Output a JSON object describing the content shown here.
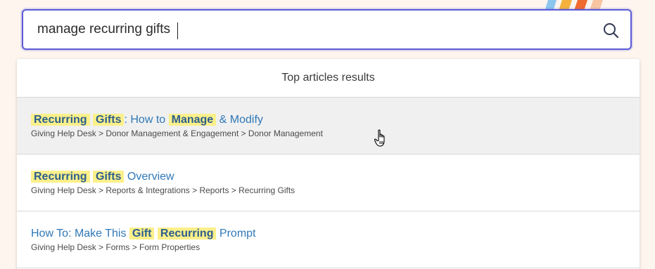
{
  "search": {
    "value": "manage recurring gifts",
    "icon": "search-icon"
  },
  "results": {
    "header": "Top articles results",
    "items": [
      {
        "title_parts": [
          {
            "text": "Recurring",
            "hl": true
          },
          {
            "text": " ",
            "hl": false
          },
          {
            "text": "Gifts",
            "hl": true
          },
          {
            "text": ": How to ",
            "hl": false
          },
          {
            "text": "Manage",
            "hl": true
          },
          {
            "text": " & Modify",
            "hl": false
          }
        ],
        "path": "Giving Help Desk > Donor Management & Engagement > Donor Management",
        "hovered": true
      },
      {
        "title_parts": [
          {
            "text": "Recurring",
            "hl": true
          },
          {
            "text": " ",
            "hl": false
          },
          {
            "text": "Gifts",
            "hl": true
          },
          {
            "text": " Overview",
            "hl": false
          }
        ],
        "path": "Giving Help Desk > Reports & Integrations > Reports > Recurring Gifts",
        "hovered": false
      },
      {
        "title_parts": [
          {
            "text": "How To: Make This ",
            "hl": false
          },
          {
            "text": "Gift",
            "hl": true
          },
          {
            "text": " ",
            "hl": false
          },
          {
            "text": "Recurring",
            "hl": true
          },
          {
            "text": " Prompt",
            "hl": false
          }
        ],
        "path": "Giving Help Desk > Forms > Form Properties",
        "hovered": false
      }
    ]
  },
  "colors": {
    "accent": "#5b5bd6",
    "highlight": "#fbf08a",
    "link": "#2f78b7",
    "background": "#fdf5ee"
  }
}
